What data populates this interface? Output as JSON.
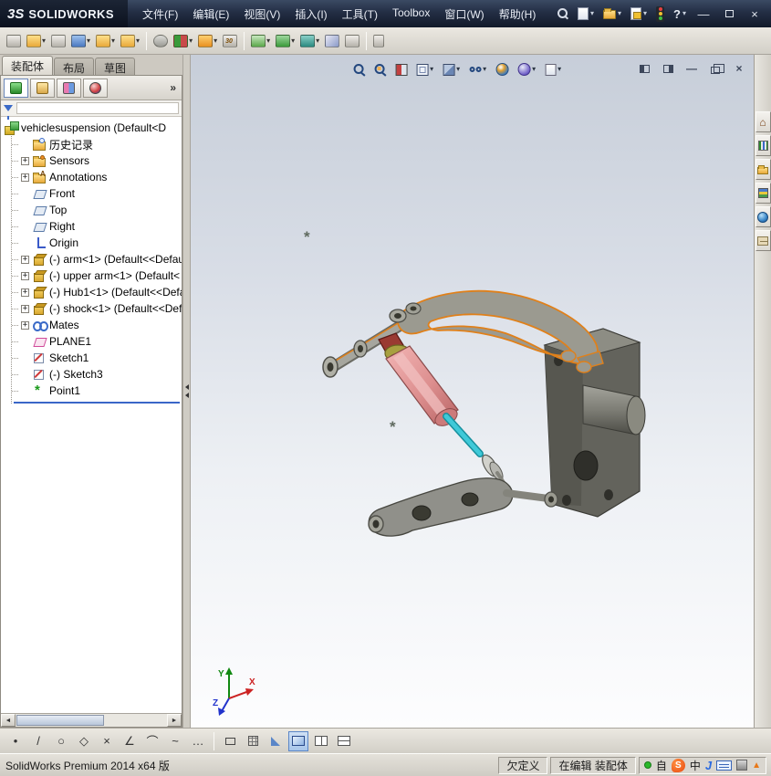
{
  "titlebar": {
    "brand_mark": "3S",
    "brand": "SOLIDWORKS",
    "menus": [
      "文件(F)",
      "编辑(E)",
      "视图(V)",
      "插入(I)",
      "工具(T)",
      "Toolbox",
      "窗口(W)",
      "帮助(H)"
    ]
  },
  "tabs": [
    {
      "label": "装配体"
    },
    {
      "label": "布局"
    },
    {
      "label": "草图"
    }
  ],
  "panel": {
    "overflow_chevron": "»"
  },
  "tree": {
    "root_label": "vehiclesuspension (Default<D",
    "items": [
      {
        "label": "历史记录"
      },
      {
        "label": "Sensors"
      },
      {
        "label": "Annotations"
      },
      {
        "label": "Front"
      },
      {
        "label": "Top"
      },
      {
        "label": "Right"
      },
      {
        "label": "Origin"
      },
      {
        "label": "(-) arm<1> (Default<<Defau"
      },
      {
        "label": "(-) upper arm<1> (Default<"
      },
      {
        "label": "(-) Hub1<1> (Default<<Defa"
      },
      {
        "label": "(-) shock<1> (Default<<Defa"
      },
      {
        "label": "Mates"
      },
      {
        "label": "PLANE1"
      },
      {
        "label": "Sketch1"
      },
      {
        "label": "(-) Sketch3"
      },
      {
        "label": "Point1"
      }
    ]
  },
  "viewport": {
    "axis_x": "X",
    "axis_y": "Y",
    "axis_z": "Z",
    "point_marker": "*"
  },
  "statusbar": {
    "left_text": "SolidWorks Premium 2014 x64 版",
    "definition_status": "欠定义",
    "edit_status": "在编辑 装配体",
    "ime_prefix": "自",
    "ime_s": "S",
    "ime_lang": "中",
    "ime_j": "J",
    "tray_arrow": "▲"
  },
  "icons": {
    "plus": "+",
    "caret": "▾",
    "minimize": "—",
    "close": "×",
    "scroll_left": "◄",
    "scroll_right": "►",
    "help": "?",
    "home": "⌂"
  }
}
